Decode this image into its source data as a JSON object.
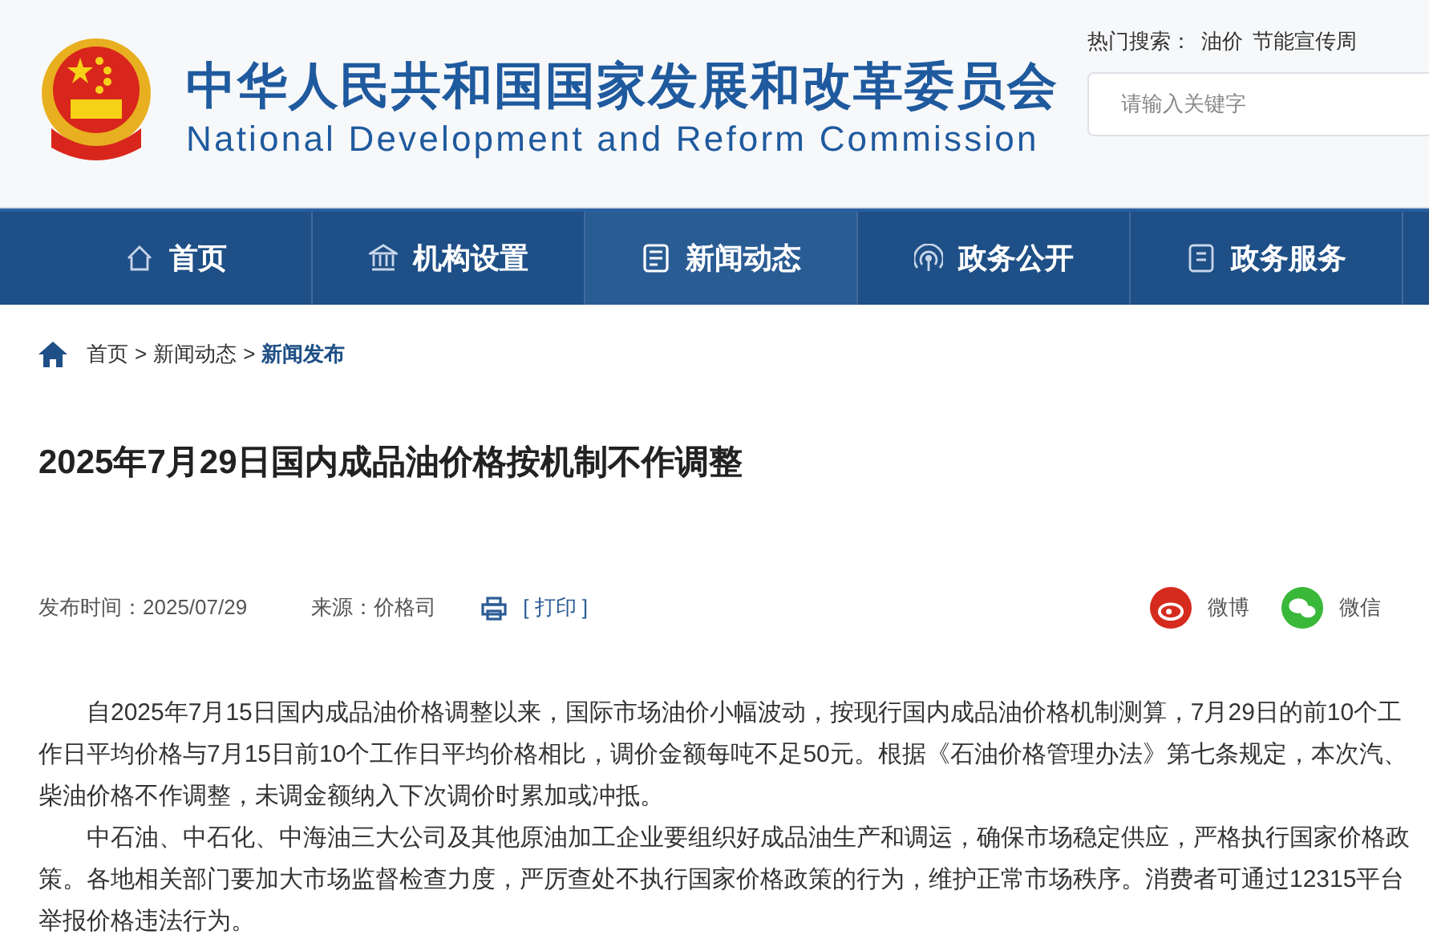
{
  "header": {
    "title": "中华人民共和国国家发展和改革委员会",
    "subtitle": "National Development and Reform Commission",
    "hot_search_label": "热门搜索：",
    "hot_terms": [
      "油价",
      "节能宣传周"
    ],
    "search": {
      "placeholder": "请输入关键字"
    }
  },
  "nav": [
    {
      "label": "首页",
      "selected": false
    },
    {
      "label": "机构设置",
      "selected": false
    },
    {
      "label": "新闻动态",
      "selected": true
    },
    {
      "label": "政务公开",
      "selected": false
    },
    {
      "label": "政务服务",
      "selected": false
    }
  ],
  "breadcrumb": [
    {
      "label": "首页",
      "current": false
    },
    {
      "label": "新闻动态",
      "current": false
    },
    {
      "label": "新闻发布",
      "current": true
    }
  ],
  "separator": ">",
  "article": {
    "title": "2025年7月29日国内成品油价格按机制不作调整",
    "published": "发布时间：2025/07/29",
    "source": "来源：价格司",
    "print": "[ 打印 ]",
    "share": [
      {
        "label": "微博",
        "kind": "weibo",
        "color": "#d52b1e"
      },
      {
        "label": "微信",
        "kind": "wechat",
        "color": "#3ab83a"
      }
    ],
    "paragraphs": [
      "自2025年7月15日国内成品油价格调整以来，国际市场油价小幅波动，按现行国内成品油价格机制测算，7月29日的前10个工作日平均价格与7月15日前10个工作日平均价格相比，调价金额每吨不足50元。根据《石油价格管理办法》第七条规定，本次汽、柴油价格不作调整，未调金额纳入下次调价时累加或冲抵。",
      "中石油、中石化、中海油三大公司及其他原油加工企业要组织好成品油生产和调运，确保市场稳定供应，严格执行国家价格政策。各地相关部门要加大市场监督检查力度，严厉查处不执行国家价格政策的行为，维护正常市场秩序。消费者可通过12315平台举报价格违法行为。"
    ]
  }
}
